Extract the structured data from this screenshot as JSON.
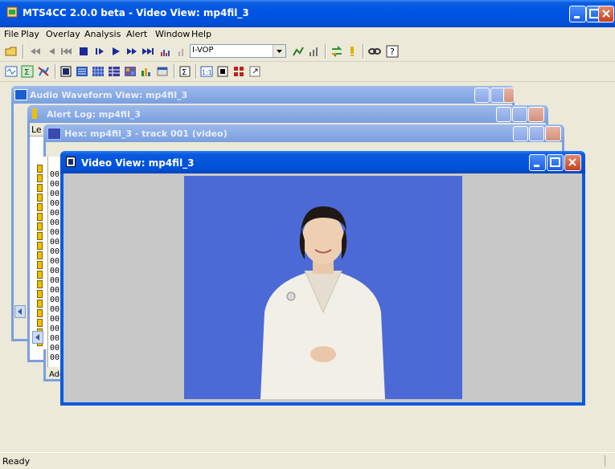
{
  "app": {
    "title": "MTS4CC 2.0.0 beta - Video View: mp4fil_3"
  },
  "menu": {
    "items": [
      "File",
      "Play",
      "Overlay",
      "Analysis",
      "Alert",
      "Window",
      "Help"
    ]
  },
  "toolbar1": {
    "frame_type_value": "I-VOP"
  },
  "windows": {
    "audio": {
      "title": "Audio Waveform View: mp4fil_3"
    },
    "alert": {
      "title": "Alert Log: mp4fil_3",
      "column_header": "Le",
      "footer_text": ""
    },
    "hex": {
      "title": "Hex: mp4fil_3 - track 001 (video)",
      "row_prefix": "00",
      "footer_text": "Add"
    },
    "video": {
      "title": "Video View: mp4fil_3"
    }
  },
  "status": {
    "text": "Ready"
  },
  "colors": {
    "title_active": "#0054e3",
    "title_inactive": "#9db9eb",
    "video_background": "#4c6ad6"
  },
  "icons": [
    "open-folder-icon",
    "rewind-icon",
    "step-back-icon",
    "play-icon",
    "stop-icon",
    "step-forward-icon",
    "fast-forward-icon",
    "skip-end-icon",
    "close-icon",
    "minimize-icon",
    "maximize-icon",
    "warning-icon",
    "help-icon"
  ]
}
